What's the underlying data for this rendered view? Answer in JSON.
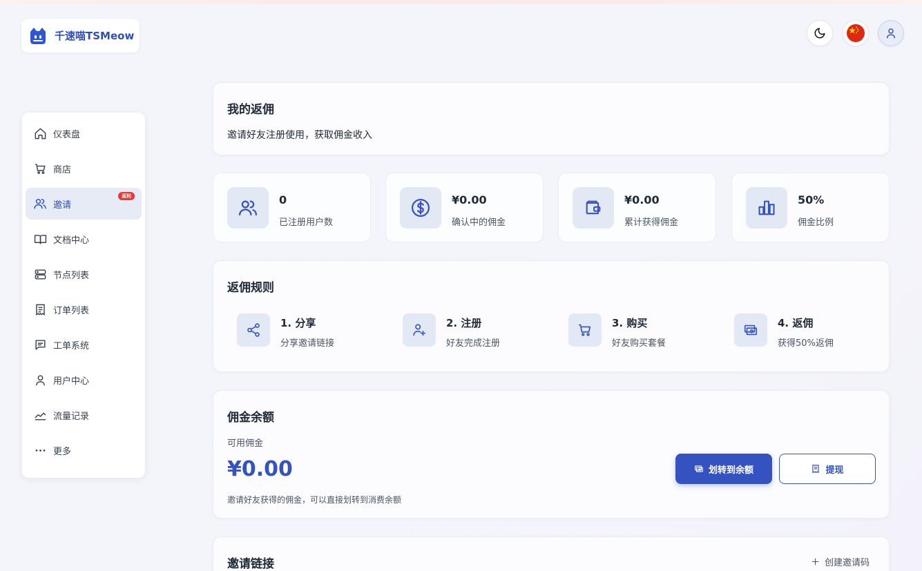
{
  "brand": {
    "name": "千速喵TSMeow"
  },
  "header": {
    "theme_toggle": "moon-icon",
    "language_flag": "china-flag-icon",
    "user_menu": "user-icon"
  },
  "sidebar": {
    "items": [
      {
        "label": "仪表盘",
        "icon": "home-icon"
      },
      {
        "label": "商店",
        "icon": "cart-icon"
      },
      {
        "label": "邀请",
        "icon": "users-icon",
        "badge": "返利",
        "active": true
      },
      {
        "label": "文档中心",
        "icon": "book-icon"
      },
      {
        "label": "节点列表",
        "icon": "server-icon"
      },
      {
        "label": "订单列表",
        "icon": "receipt-icon"
      },
      {
        "label": "工单系统",
        "icon": "message-icon"
      },
      {
        "label": "用户中心",
        "icon": "user-icon"
      },
      {
        "label": "流量记录",
        "icon": "chart-line-icon"
      },
      {
        "label": "更多",
        "icon": "more-icon"
      }
    ]
  },
  "intro": {
    "title": "我的返佣",
    "description": "邀请好友注册使用，获取佣金收入"
  },
  "stats": [
    {
      "value": "0",
      "label": "已注册用户数",
      "icon": "users-icon"
    },
    {
      "value": "¥0.00",
      "label": "确认中的佣金",
      "icon": "dollar-icon"
    },
    {
      "value": "¥0.00",
      "label": "累计获得佣金",
      "icon": "wallet-icon"
    },
    {
      "value": "50%",
      "label": "佣金比例",
      "icon": "bar-chart-icon"
    }
  ],
  "rules": {
    "title": "返佣规则",
    "steps": [
      {
        "title": "1. 分享",
        "desc": "分享邀请链接",
        "icon": "share-icon"
      },
      {
        "title": "2. 注册",
        "desc": "好友完成注册",
        "icon": "user-plus-icon"
      },
      {
        "title": "3. 购买",
        "desc": "好友购买套餐",
        "icon": "cart-icon"
      },
      {
        "title": "4. 返佣",
        "desc": "获得50%返佣",
        "icon": "money-icon"
      }
    ]
  },
  "balance": {
    "title": "佣金余额",
    "available_label": "可用佣金",
    "amount": "¥0.00",
    "note": "邀请好友获得的佣金，可以直接划转到消费余额",
    "transfer_button": "划转到余额",
    "withdraw_button": "提现"
  },
  "invite_links": {
    "title": "邀请链接",
    "create_button": "创建邀请码"
  },
  "colors": {
    "accent": "#3553c0",
    "badge": "#e53935",
    "icon_bg": "#e3e8f5"
  }
}
